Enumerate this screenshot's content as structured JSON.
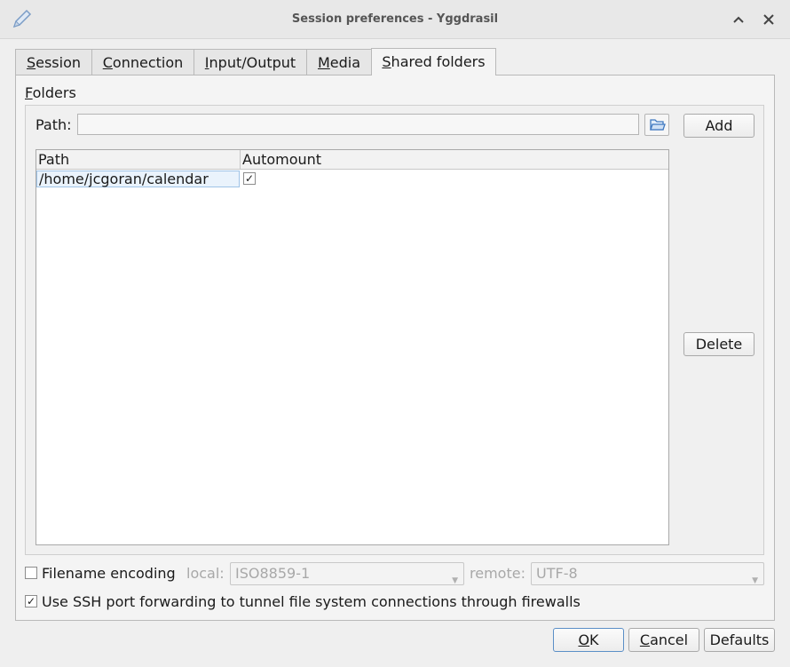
{
  "window": {
    "title": "Session preferences - Yggdrasil"
  },
  "tabs": [
    {
      "label": "Session",
      "mnemonic": "S",
      "rest": "ession"
    },
    {
      "label": "Connection",
      "mnemonic": "C",
      "rest": "onnection"
    },
    {
      "label": "Input/Output",
      "mnemonic": "I",
      "rest": "nput/Output"
    },
    {
      "label": "Media",
      "mnemonic": "M",
      "rest": "edia"
    },
    {
      "label": "Shared folders",
      "mnemonic": "S",
      "rest": "hared folders",
      "active": true
    }
  ],
  "folders": {
    "group_label_mnemonic": "F",
    "group_label_rest": "olders",
    "path_label": "Path:",
    "path_value": "",
    "add_label": "Add",
    "delete_label": "Delete",
    "columns": [
      "Path",
      "Automount"
    ],
    "rows": [
      {
        "path": "/home/jcgoran/calendar",
        "automount": "✓"
      }
    ]
  },
  "encoding": {
    "label": "Filename encoding",
    "checked": "",
    "local_label": "local:",
    "local_value": "ISO8859-1",
    "remote_label": "remote:",
    "remote_value": "UTF-8"
  },
  "ssh": {
    "checked": "✓",
    "label": "Use SSH port forwarding to tunnel file system connections through firewalls"
  },
  "footer": {
    "ok_mnemonic": "O",
    "ok_rest": "K",
    "cancel_mnemonic": "C",
    "cancel_rest": "ancel",
    "defaults_label": "Defaults"
  },
  "icons": {
    "app": "pen-icon",
    "maximize": "chevron-up-icon",
    "close": "close-icon",
    "browse": "folder-open-icon",
    "dropdown": "chevron-down-icon"
  },
  "colors": {
    "accent": "#5b8fc7",
    "selection": "#eaf3fc"
  }
}
